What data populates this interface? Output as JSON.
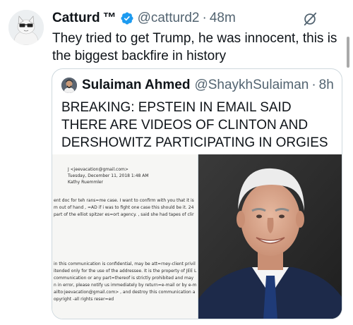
{
  "tweet": {
    "author_name": "Catturd",
    "trademark": "™",
    "handle": "@catturd2",
    "separator": "·",
    "time": "48m",
    "text": "They tried to get Trump, he was innocent, this is the biggest backfire in history"
  },
  "quoted": {
    "author_name": "Sulaiman Ahmed",
    "handle": "@ShaykhSulaiman",
    "separator": "·",
    "time": "8h",
    "text": "BREAKING: EPSTEIN IN EMAIL SAID THERE ARE VIDEOS OF CLINTON AND DERSHOWITZ PARTICIPATING IN ORGIES",
    "document_lines": [
      "J <jeevacation@gmail.com>",
      "Tuesday, December 11, 2018 1:48 AM",
      "Kathy Ruemmler",
      "ent doc for teh rans=me case.   I want to confirm with you that it is",
      "m out of hand , =AD if i was to fight one case this should be it.  24",
      "part of the elliot spitzer es=ort agency.  , said she had tapes of clir",
      "in this communication is confidential, may be att=rney-client privil",
      "itended only for the use of the addressee. It is the property of JEE L",
      "communication or any part=thereof is strictly prohibited and may",
      "n in error, please notify us immediately by return=e-mail or by e-m",
      "ailto:jeevacation@gmail.com> , and destroy this communication a",
      "opyright -all rights reser=ed"
    ]
  },
  "icons": {
    "verified": "verified-badge-icon",
    "grok": "grok-icon"
  },
  "colors": {
    "verified_blue": "#1d9bf0",
    "secondary_text": "#536471",
    "border": "#cfd9de"
  }
}
